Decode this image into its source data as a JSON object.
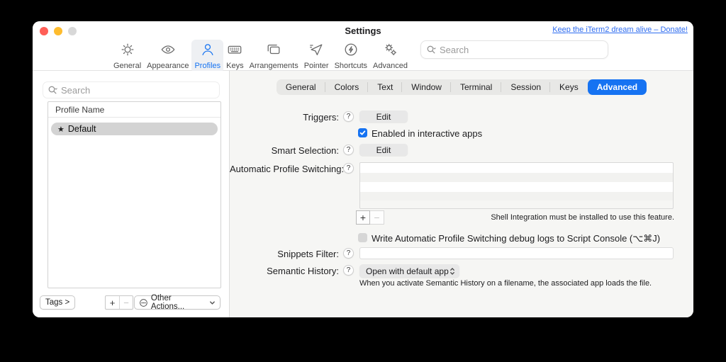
{
  "colors": {
    "accent": "#1673f2",
    "link_blue": "#2d6bf0"
  },
  "titlebar": {
    "title": "Settings",
    "donate_link": "Keep the iTerm2 dream alive – Donate!"
  },
  "toolbar": {
    "search_placeholder": "Search",
    "selected": "Profiles",
    "items": [
      {
        "label": "General",
        "icon": "gear-icon"
      },
      {
        "label": "Appearance",
        "icon": "eye-icon"
      },
      {
        "label": "Profiles",
        "icon": "person-icon"
      },
      {
        "label": "Keys",
        "icon": "keyboard-icon"
      },
      {
        "label": "Arrangements",
        "icon": "windows-icon"
      },
      {
        "label": "Pointer",
        "icon": "cursor-icon"
      },
      {
        "label": "Shortcuts",
        "icon": "bolt-circle-icon"
      },
      {
        "label": "Advanced",
        "icon": "gears-icon"
      }
    ]
  },
  "sidebar": {
    "search_placeholder": "Search",
    "list_header": "Profile Name",
    "selected_profile": {
      "star": "★",
      "name": "Default"
    },
    "tags_button": "Tags >",
    "add_button": "+",
    "remove_button": "−",
    "other_actions": "Other Actions..."
  },
  "tabs": {
    "selected": "Advanced",
    "items": [
      "General",
      "Colors",
      "Text",
      "Window",
      "Terminal",
      "Session",
      "Keys",
      "Advanced"
    ]
  },
  "form": {
    "help": "?",
    "triggers": {
      "label": "Triggers:",
      "edit": "Edit",
      "checkbox_label": "Enabled in interactive apps",
      "checked": true
    },
    "smart_selection": {
      "label": "Smart Selection:",
      "edit": "Edit"
    },
    "aps": {
      "label": "Automatic Profile Switching:",
      "add": "+",
      "remove": "−",
      "note": "Shell Integration must be installed to use this feature.",
      "debug_checkbox_label": "Write Automatic Profile Switching debug logs to Script Console (⌥⌘J)",
      "debug_checked": false
    },
    "snippets": {
      "label": "Snippets Filter:",
      "value": ""
    },
    "semantic": {
      "label": "Semantic History:",
      "value": "Open with default app",
      "caption": "When you activate Semantic History on a filename, the associated app loads the file."
    }
  }
}
